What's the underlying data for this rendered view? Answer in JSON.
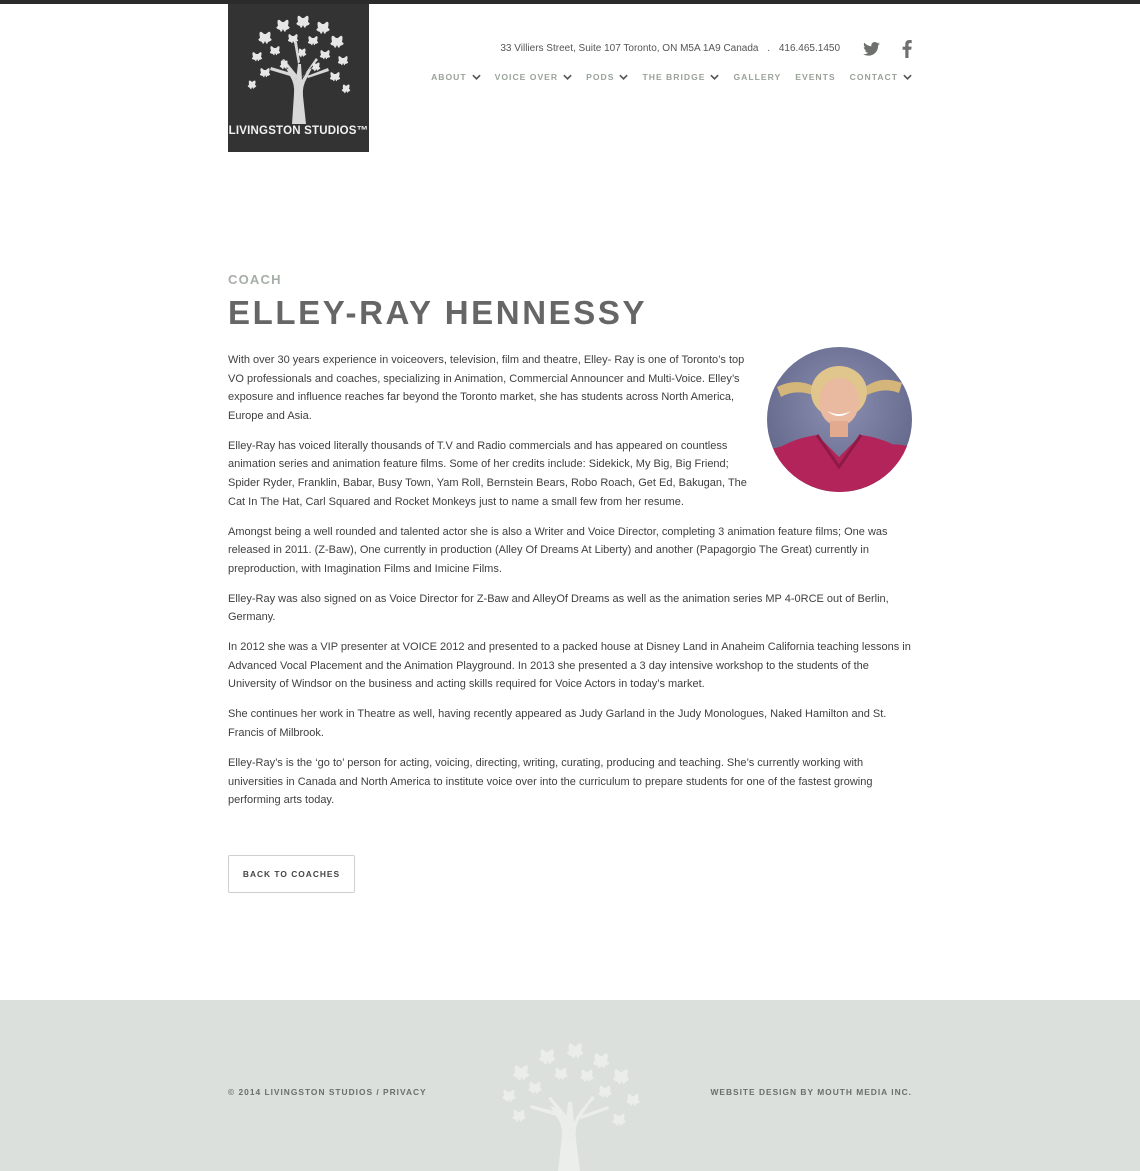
{
  "header": {
    "logo_text": "LIVINGSTON STUDIOS™",
    "address": "33 Villiers Street, Suite 107 Toronto, ON M5A 1A9 Canada",
    "separator": ".",
    "phone": "416.465.1450",
    "social": [
      "twitter-icon",
      "facebook-icon"
    ]
  },
  "nav": {
    "about": "ABOUT",
    "voice_over": "VOICE OVER",
    "pods": "PODS",
    "the_bridge": "THE BRIDGE",
    "gallery": "GALLERY",
    "events": "EVENTS",
    "contact": "CONTACT"
  },
  "main": {
    "kicker": "COACH",
    "title": "ELLEY-RAY HENNESSY",
    "paragraphs": [
      "With over 30 years experience in voiceovers, television, film and theatre, Elley- Ray is one of Toronto’s top VO professionals and coaches, specializing in Animation, Commercial Announcer and Multi-Voice. Elley’s exposure and influence reaches far beyond the Toronto market, she has students across North America, Europe and Asia.",
      "Elley-Ray has voiced literally thousands of T.V and Radio commercials and has appeared on countless animation series and animation feature films. Some of her credits include: Sidekick, My Big, Big Friend; Spider Ryder, Franklin, Babar, Busy Town, Yam Roll, Bernstein Bears, Robo Roach, Get Ed, Bakugan, The Cat In The Hat, Carl Squared and Rocket Monkeys just to name a small few from her resume.",
      "Amongst being a well rounded and talented actor she is also a Writer and Voice Director, completing 3 animation feature films; One was released in 2011. (Z-Baw), One currently in production (Alley Of Dreams At Liberty) and another (Papagorgio The Great) currently in preproduction, with Imagination Films and Imicine Films.",
      "Elley-Ray was also signed on as Voice Director for Z-Baw and AlleyOf Dreams as well as the animation series MP 4-0RCE out of Berlin, Germany.",
      "In 2012 she was a VIP presenter at VOICE 2012 and presented to a packed house at Disney Land in Anaheim California teaching lessons in Advanced Vocal Placement and the Animation Playground. In 2013 she presented a 3 day intensive workshop to the students of the University of Windsor on the business and acting skills required for Voice Actors in today’s market.",
      "She continues her work in Theatre as well, having recently appeared as Judy Garland in the Judy Monologues, Naked Hamilton and St. Francis of Milbrook.",
      "Elley-Ray’s is the ‘go to’ person for acting, voicing, directing, writing, curating, producing and teaching. She’s currently working with universities in Canada and North America to institute voice over into the curriculum to prepare students for one of the fastest growing performing arts today."
    ],
    "back_button": "BACK TO COACHES"
  },
  "footer": {
    "copyright": "© 2014 LIVINGSTON STUDIOS",
    "divider": " / ",
    "privacy": "PRIVACY",
    "credit": "WEBSITE DESIGN BY MOUTH MEDIA INC."
  },
  "colors": {
    "topbar": "#2b2b2b",
    "logo_bg": "#333333",
    "nav_text": "#9aa29a",
    "title": "#666666",
    "footer_bg": "#dbe0dc"
  }
}
